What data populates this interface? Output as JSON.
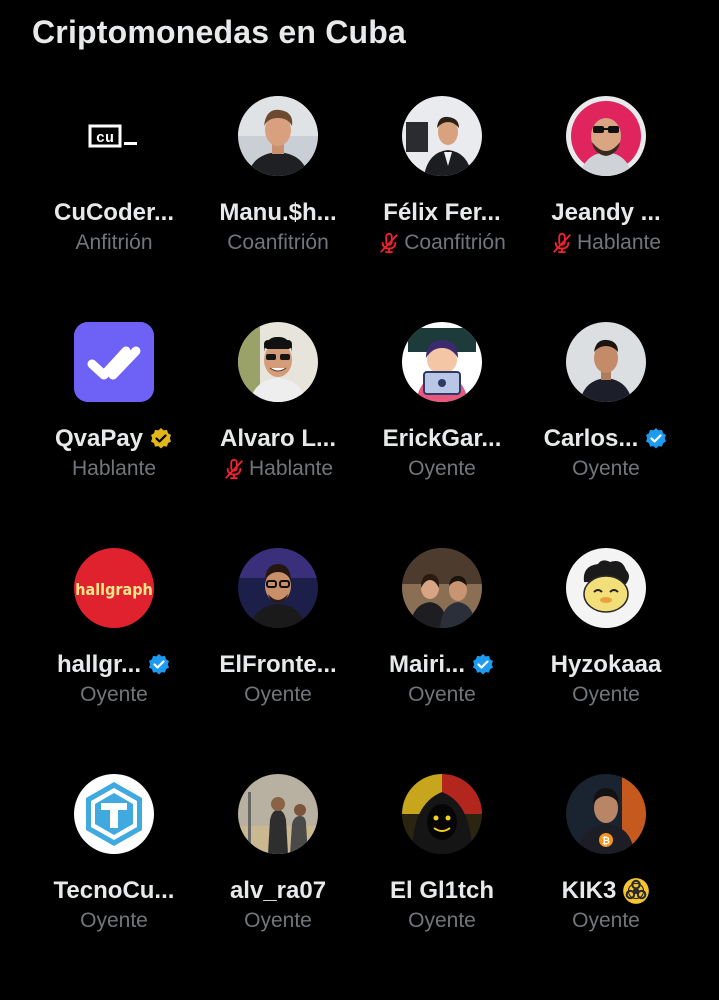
{
  "space": {
    "title": "Criptomonedas en Cuba"
  },
  "participants": [
    {
      "name": "CuCoder...",
      "role": "Anfitrión",
      "verified": null,
      "muted": false,
      "avatar": "cucoder-logo"
    },
    {
      "name": "Manu.$h...",
      "role": "Coanfitrión",
      "verified": null,
      "muted": false,
      "avatar": "person-photo"
    },
    {
      "name": "Félix Fer...",
      "role": "Coanfitrión",
      "verified": null,
      "muted": true,
      "avatar": "person-photo"
    },
    {
      "name": "Jeandy ...",
      "role": "Hablante",
      "verified": null,
      "muted": true,
      "avatar": "person-photo"
    },
    {
      "name": "QvaPay",
      "role": "Hablante",
      "verified": "gold",
      "muted": false,
      "avatar": "qvapay-logo"
    },
    {
      "name": "Alvaro L...",
      "role": "Hablante",
      "verified": null,
      "muted": true,
      "avatar": "person-photo"
    },
    {
      "name": "ErickGar...",
      "role": "Oyente",
      "verified": null,
      "muted": false,
      "avatar": "cartoon-avatar"
    },
    {
      "name": "Carlos...",
      "role": "Oyente",
      "verified": "blue",
      "muted": false,
      "avatar": "person-photo"
    },
    {
      "name": "hallgr...",
      "role": "Oyente",
      "verified": "blue",
      "muted": false,
      "avatar": "hallgraph-logo",
      "logo_text": "hallgraph"
    },
    {
      "name": "ElFronte...",
      "role": "Oyente",
      "verified": null,
      "muted": false,
      "avatar": "person-photo"
    },
    {
      "name": "Mairi...",
      "role": "Oyente",
      "verified": "blue",
      "muted": false,
      "avatar": "person-photo"
    },
    {
      "name": "Hyzokaaa",
      "role": "Oyente",
      "verified": null,
      "muted": false,
      "avatar": "cartoon-avatar"
    },
    {
      "name": "TecnoCu...",
      "role": "Oyente",
      "verified": null,
      "muted": false,
      "avatar": "tecnocuba-logo"
    },
    {
      "name": "alv_ra07",
      "role": "Oyente",
      "verified": null,
      "muted": false,
      "avatar": "person-photo"
    },
    {
      "name": "El Gl1tch",
      "role": "Oyente",
      "verified": null,
      "muted": false,
      "avatar": "hooded-figure"
    },
    {
      "name": "KIK3",
      "role": "Oyente",
      "verified": null,
      "muted": false,
      "emoji": "☣️",
      "avatar": "person-photo"
    }
  ],
  "colors": {
    "background": "#000000",
    "text_primary": "#e7e9ea",
    "text_secondary": "#71767b",
    "verified_blue": "#1d9bf0",
    "verified_gold": "#e2b719",
    "muted_mic": "#f4212e"
  }
}
